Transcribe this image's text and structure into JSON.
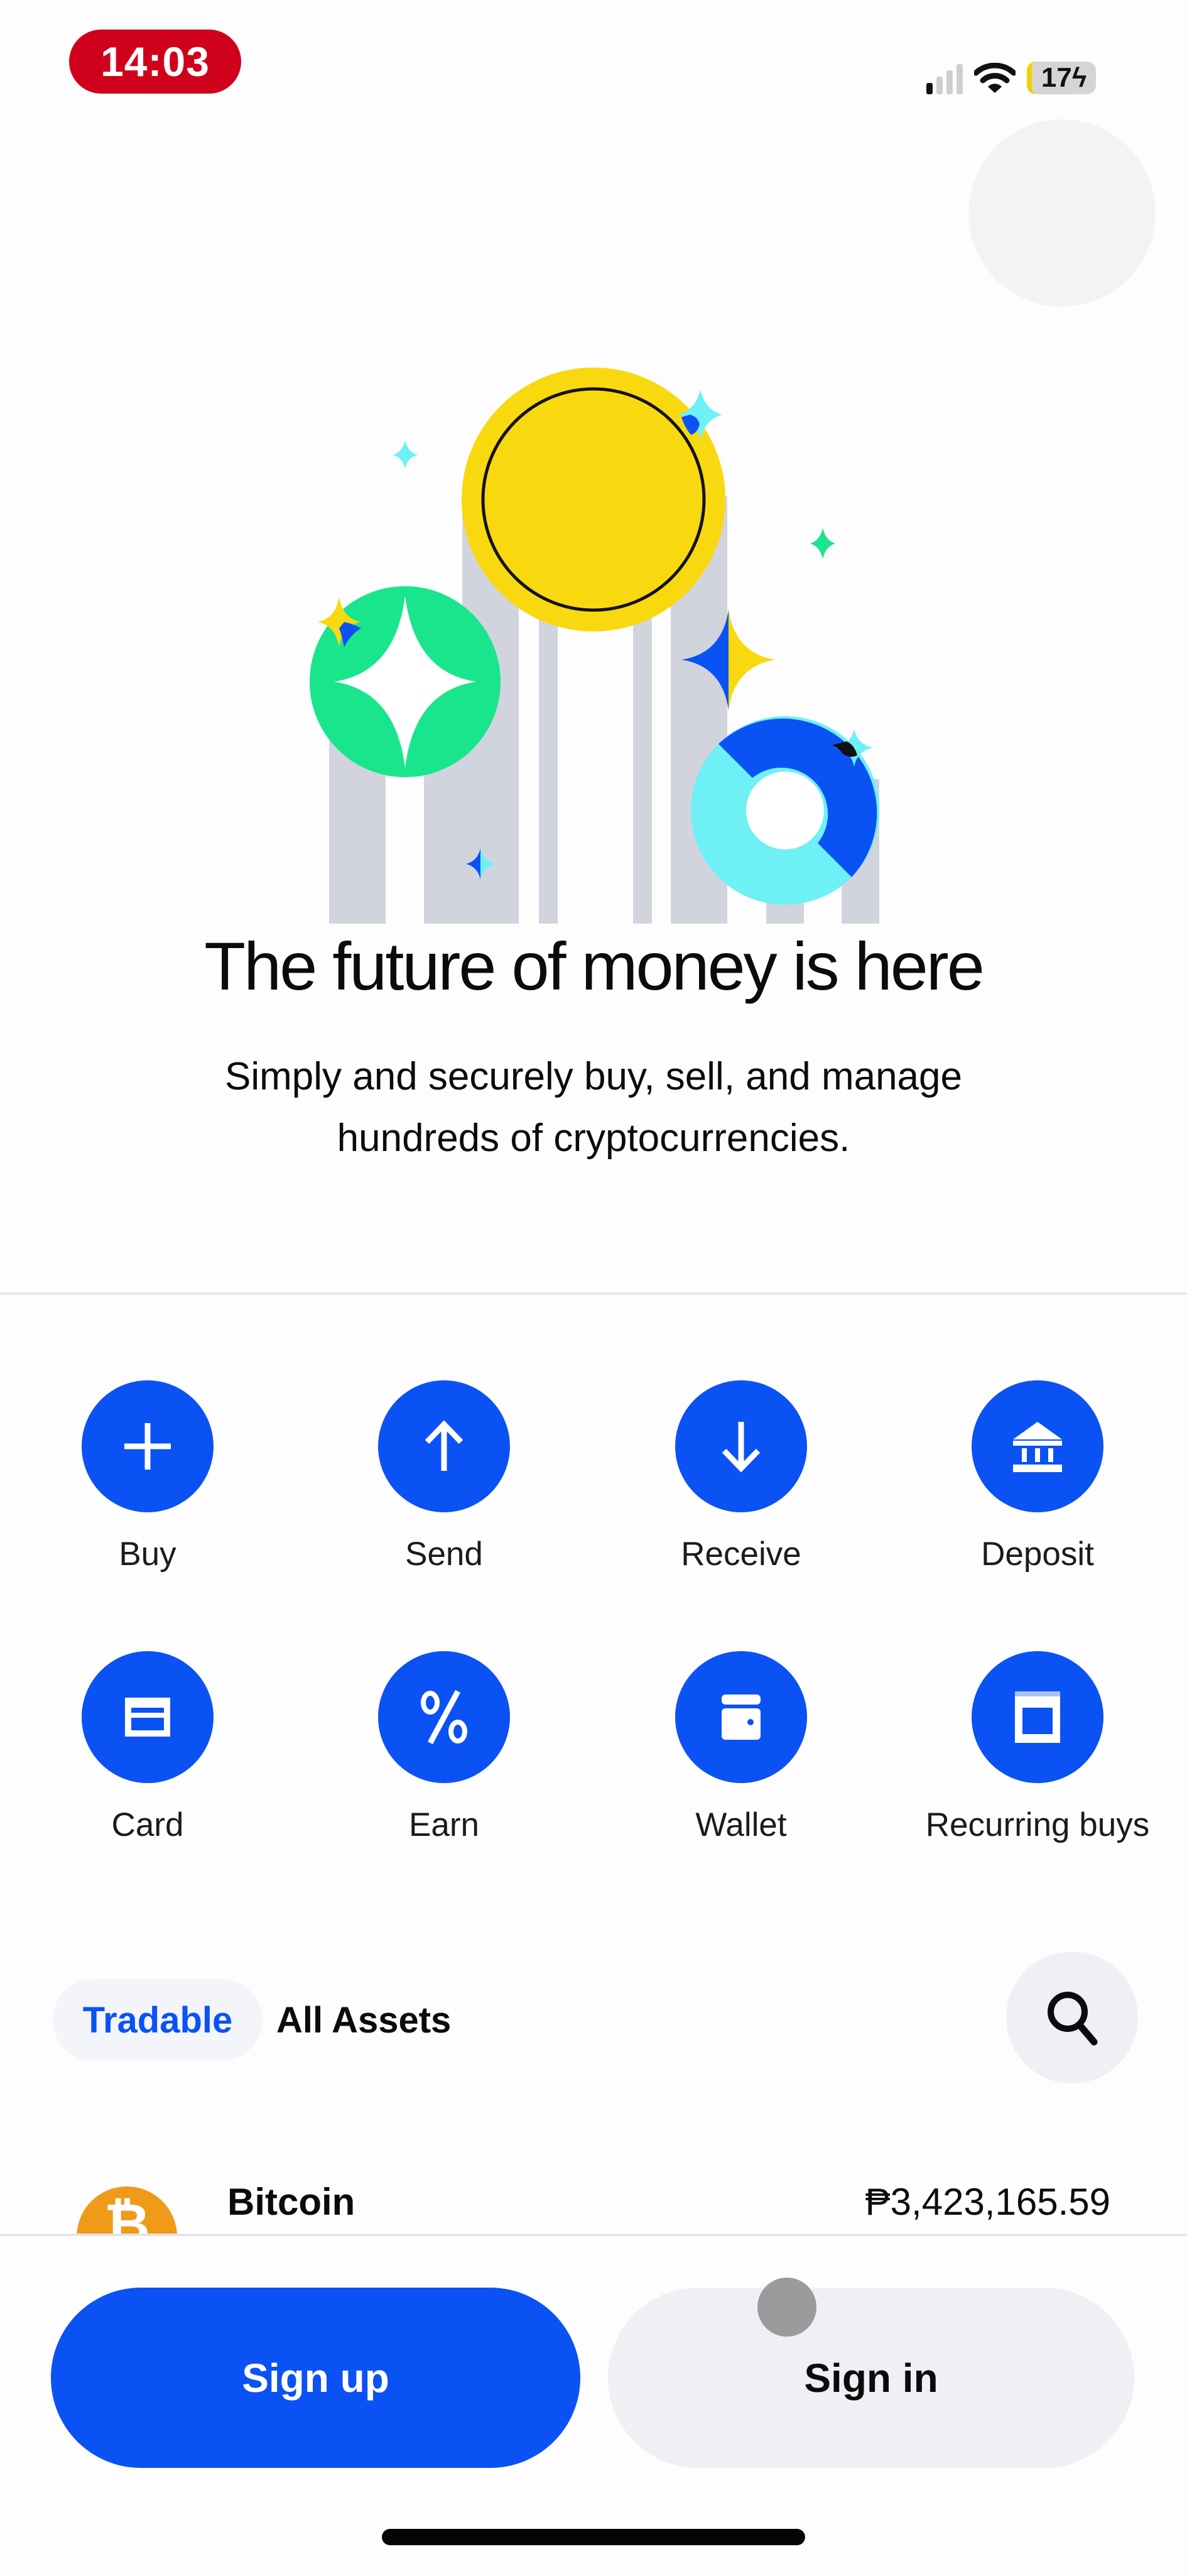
{
  "status_bar": {
    "time": "14:03",
    "battery": "17",
    "icons": [
      "cellular-signal-icon",
      "wifi-icon",
      "battery-charging-icon"
    ]
  },
  "header": {
    "close_button_icon": "blank-circle-button"
  },
  "hero": {
    "title": "The future of money is here",
    "subtitle": "Simply and securely buy, sell, and manage hundreds of cryptocurrencies.",
    "illustration": "coins-and-sparkles-illustration"
  },
  "colors": {
    "brand_blue": "#0b52f5",
    "coin_yellow": "#f8d90f",
    "coin_green": "#19e68c",
    "coin_cyan": "#6ef0f5",
    "bitcoin_orange": "#f09a1a",
    "status_red": "#d0021b"
  },
  "quick_actions": [
    {
      "label": "Buy",
      "icon": "plus-icon"
    },
    {
      "label": "Send",
      "icon": "arrow-up-icon"
    },
    {
      "label": "Receive",
      "icon": "arrow-down-icon"
    },
    {
      "label": "Deposit",
      "icon": "bank-icon"
    },
    {
      "label": "Card",
      "icon": "card-icon"
    },
    {
      "label": "Earn",
      "icon": "percent-icon"
    },
    {
      "label": "Wallet",
      "icon": "wallet-icon"
    },
    {
      "label": "Recurring buys",
      "icon": "calendar-icon"
    }
  ],
  "asset_tabs": {
    "active": "Tradable",
    "tabs": [
      "Tradable",
      "All Assets"
    ],
    "search_icon": "search-icon"
  },
  "assets": [
    {
      "name": "Bitcoin",
      "price": "₱3,423,165.59",
      "icon_glyph": "₿"
    }
  ],
  "footer": {
    "signup_label": "Sign up",
    "signin_label": "Sign in"
  }
}
